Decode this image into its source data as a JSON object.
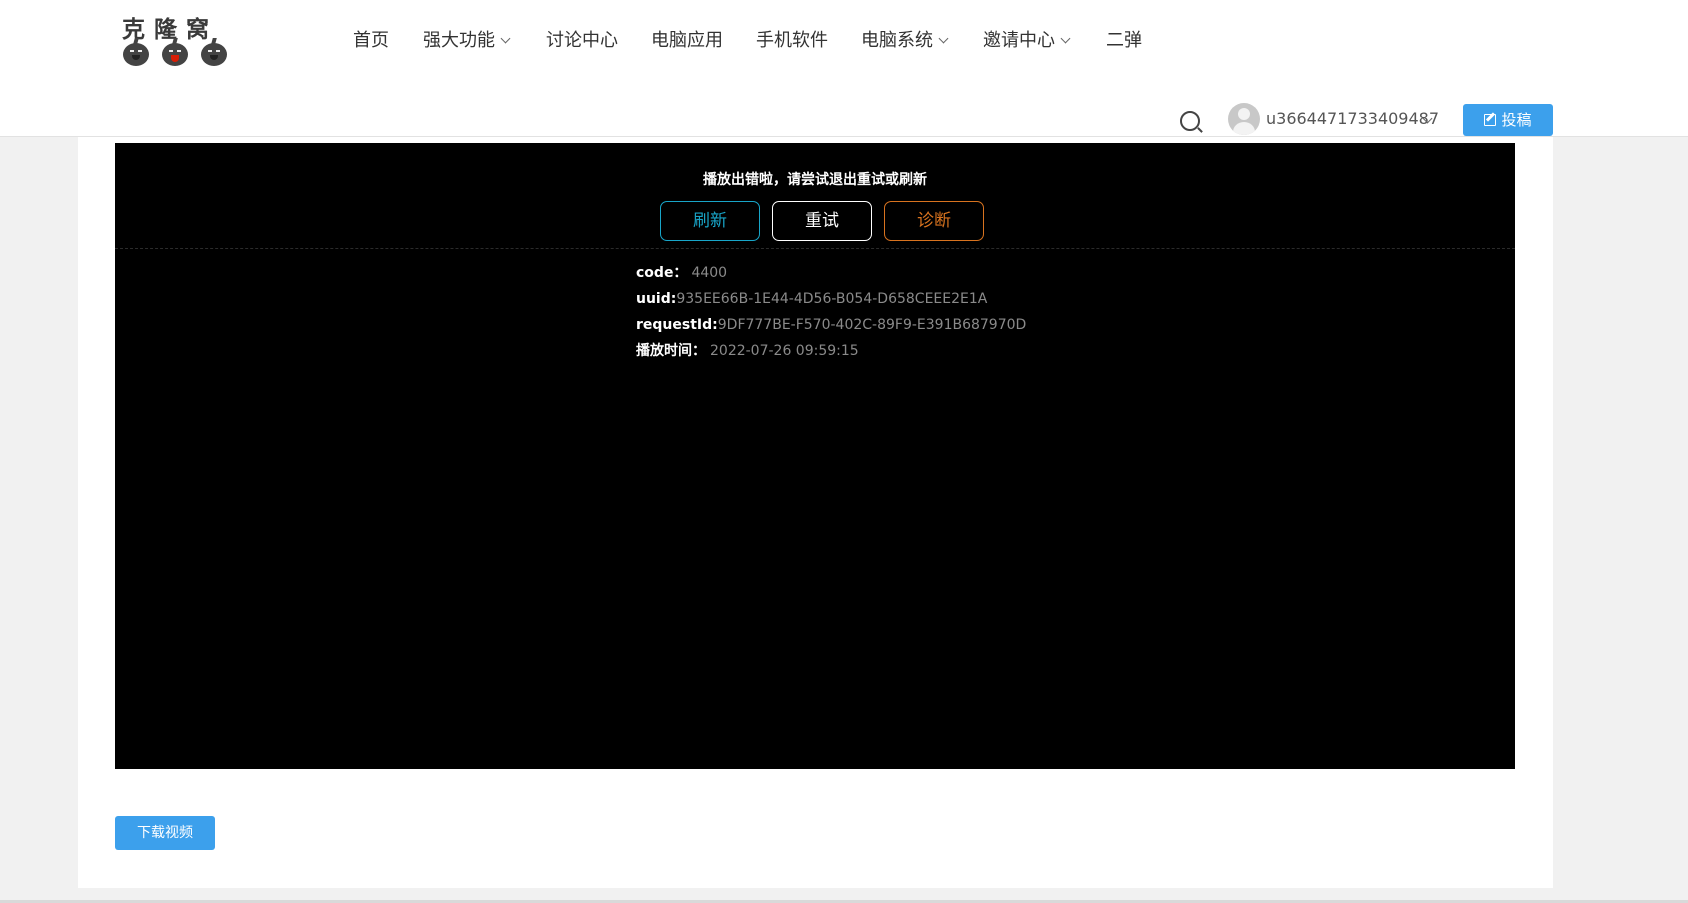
{
  "header": {
    "logo": {
      "text": "克隆窝"
    },
    "nav": [
      {
        "label": "首页",
        "has_dropdown": false
      },
      {
        "label": "强大功能",
        "has_dropdown": true
      },
      {
        "label": "讨论中心",
        "has_dropdown": false
      },
      {
        "label": "电脑应用",
        "has_dropdown": false
      },
      {
        "label": "手机软件",
        "has_dropdown": false
      },
      {
        "label": "电脑系统",
        "has_dropdown": true
      },
      {
        "label": "邀请中心",
        "has_dropdown": true
      },
      {
        "label": "二弹",
        "has_dropdown": false
      }
    ],
    "search_icon": "search-icon",
    "user": {
      "name": "u3664471733409487",
      "avatar_icon": "user-avatar-icon"
    },
    "post_button": {
      "label": "投稿",
      "icon": "edit-icon"
    }
  },
  "player": {
    "error_title": "播放出错啦，请尝试退出重试或刷新",
    "buttons": {
      "refresh": "刷新",
      "retry": "重试",
      "diagnose": "诊断"
    },
    "info": {
      "code_label": "code：",
      "code_value": "4400",
      "uuid_label": "uuid:",
      "uuid_value": "935EE66B-1E44-4D56-B054-D658CEEE2E1A",
      "request_label": "requestId:",
      "request_value": "9DF777BE-F570-402C-89F9-E391B687970D",
      "time_label": "播放时间：",
      "time_value": "2022-07-26 09:59:15"
    }
  },
  "download_button": "下载视频",
  "colors": {
    "accent": "#3ca0ec",
    "refresh": "#18a5c8",
    "diagnose": "#d8731f"
  }
}
